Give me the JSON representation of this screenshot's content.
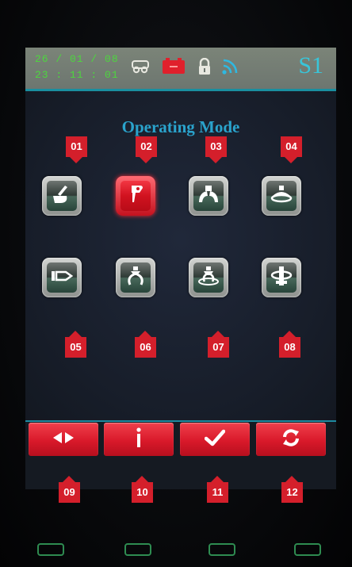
{
  "status": {
    "date": "26 / 01 / 08",
    "time": "23 : 11 : 01",
    "mode_tag": "S1",
    "icons": [
      "engine-icon",
      "battery-icon",
      "lock-icon",
      "signal-icon"
    ],
    "colors": {
      "datetime": "#4dd63e",
      "mode_tag": "#38c6da",
      "battery": "#e0202c"
    }
  },
  "title": "Operating Mode",
  "modes": [
    {
      "number": "01",
      "icon": "bucket-icon",
      "active": false
    },
    {
      "number": "02",
      "icon": "hammer-icon",
      "active": true
    },
    {
      "number": "03",
      "icon": "clamshell-grab-icon",
      "active": false
    },
    {
      "number": "04",
      "icon": "compactor-icon",
      "active": false
    },
    {
      "number": "05",
      "icon": "shear-icon",
      "active": false
    },
    {
      "number": "06",
      "icon": "grapple-icon",
      "active": false
    },
    {
      "number": "07",
      "icon": "rotating-grab-icon",
      "active": false
    },
    {
      "number": "08",
      "icon": "tiltrotator-icon",
      "active": false
    }
  ],
  "function_buttons": [
    {
      "number": "09",
      "icon": "left-right-arrows-icon"
    },
    {
      "number": "10",
      "icon": "info-icon"
    },
    {
      "number": "11",
      "icon": "checkmark-icon"
    },
    {
      "number": "12",
      "icon": "refresh-icon"
    }
  ],
  "accent": {
    "marker_red": "#d41f2b",
    "title_blue": "#2aa3cc"
  }
}
